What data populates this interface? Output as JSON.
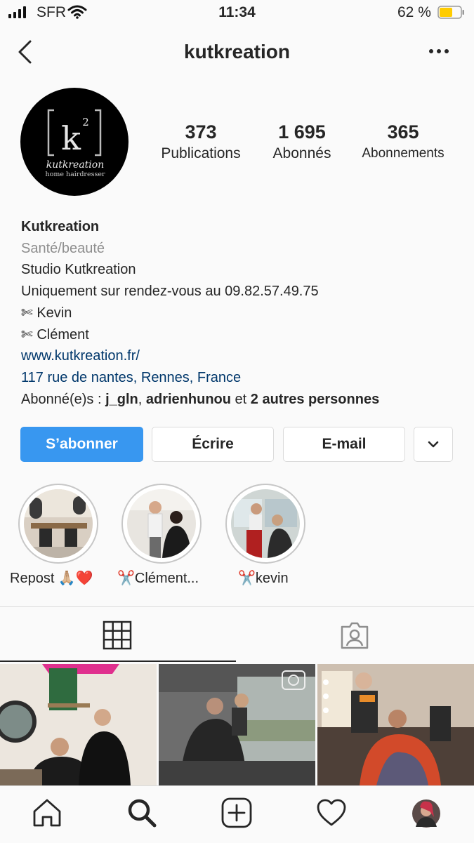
{
  "status_bar": {
    "carrier": "SFR",
    "time": "11:34",
    "battery_percent": "62 %",
    "battery_level": 0.62,
    "battery_color": "#ffcc00"
  },
  "header": {
    "username": "kutkreation"
  },
  "avatar": {
    "logo_mark": "k",
    "logo_sup": "2",
    "logo_name": "kutkreation",
    "logo_tagline": "home hairdresser"
  },
  "stats": [
    {
      "value": "373",
      "label": "Publications"
    },
    {
      "value": "1 695",
      "label": "Abonnés"
    },
    {
      "value": "365",
      "label": "Abonnements"
    }
  ],
  "bio": {
    "name": "Kutkreation",
    "category": "Santé/beauté",
    "line1": "Studio Kutkreation",
    "line2": "Uniquement sur rendez-vous au 09.82.57.49.75",
    "line3": "✄ Kevin",
    "line4": "✄ Clément",
    "website": "www.kutkreation.fr/",
    "address": "117 rue de nantes, Rennes, France",
    "followed_prefix": "Abonné(e)s : ",
    "followed_user1": "j_gln",
    "followed_sep": ", ",
    "followed_user2": "adrienhunou",
    "followed_and": " et ",
    "followed_more": "2 autres personnes"
  },
  "actions": {
    "follow": "S’abonner",
    "message": "Écrire",
    "email": "E-mail"
  },
  "highlights": [
    {
      "label": "Repost 🙏🏼❤️"
    },
    {
      "label": "✂️Clément..."
    },
    {
      "label": "✂️kevin"
    }
  ],
  "colors": {
    "primary": "#3897f0",
    "link": "#00376b",
    "secondary_text": "#8e8e8e",
    "border": "#dbdbdb"
  }
}
